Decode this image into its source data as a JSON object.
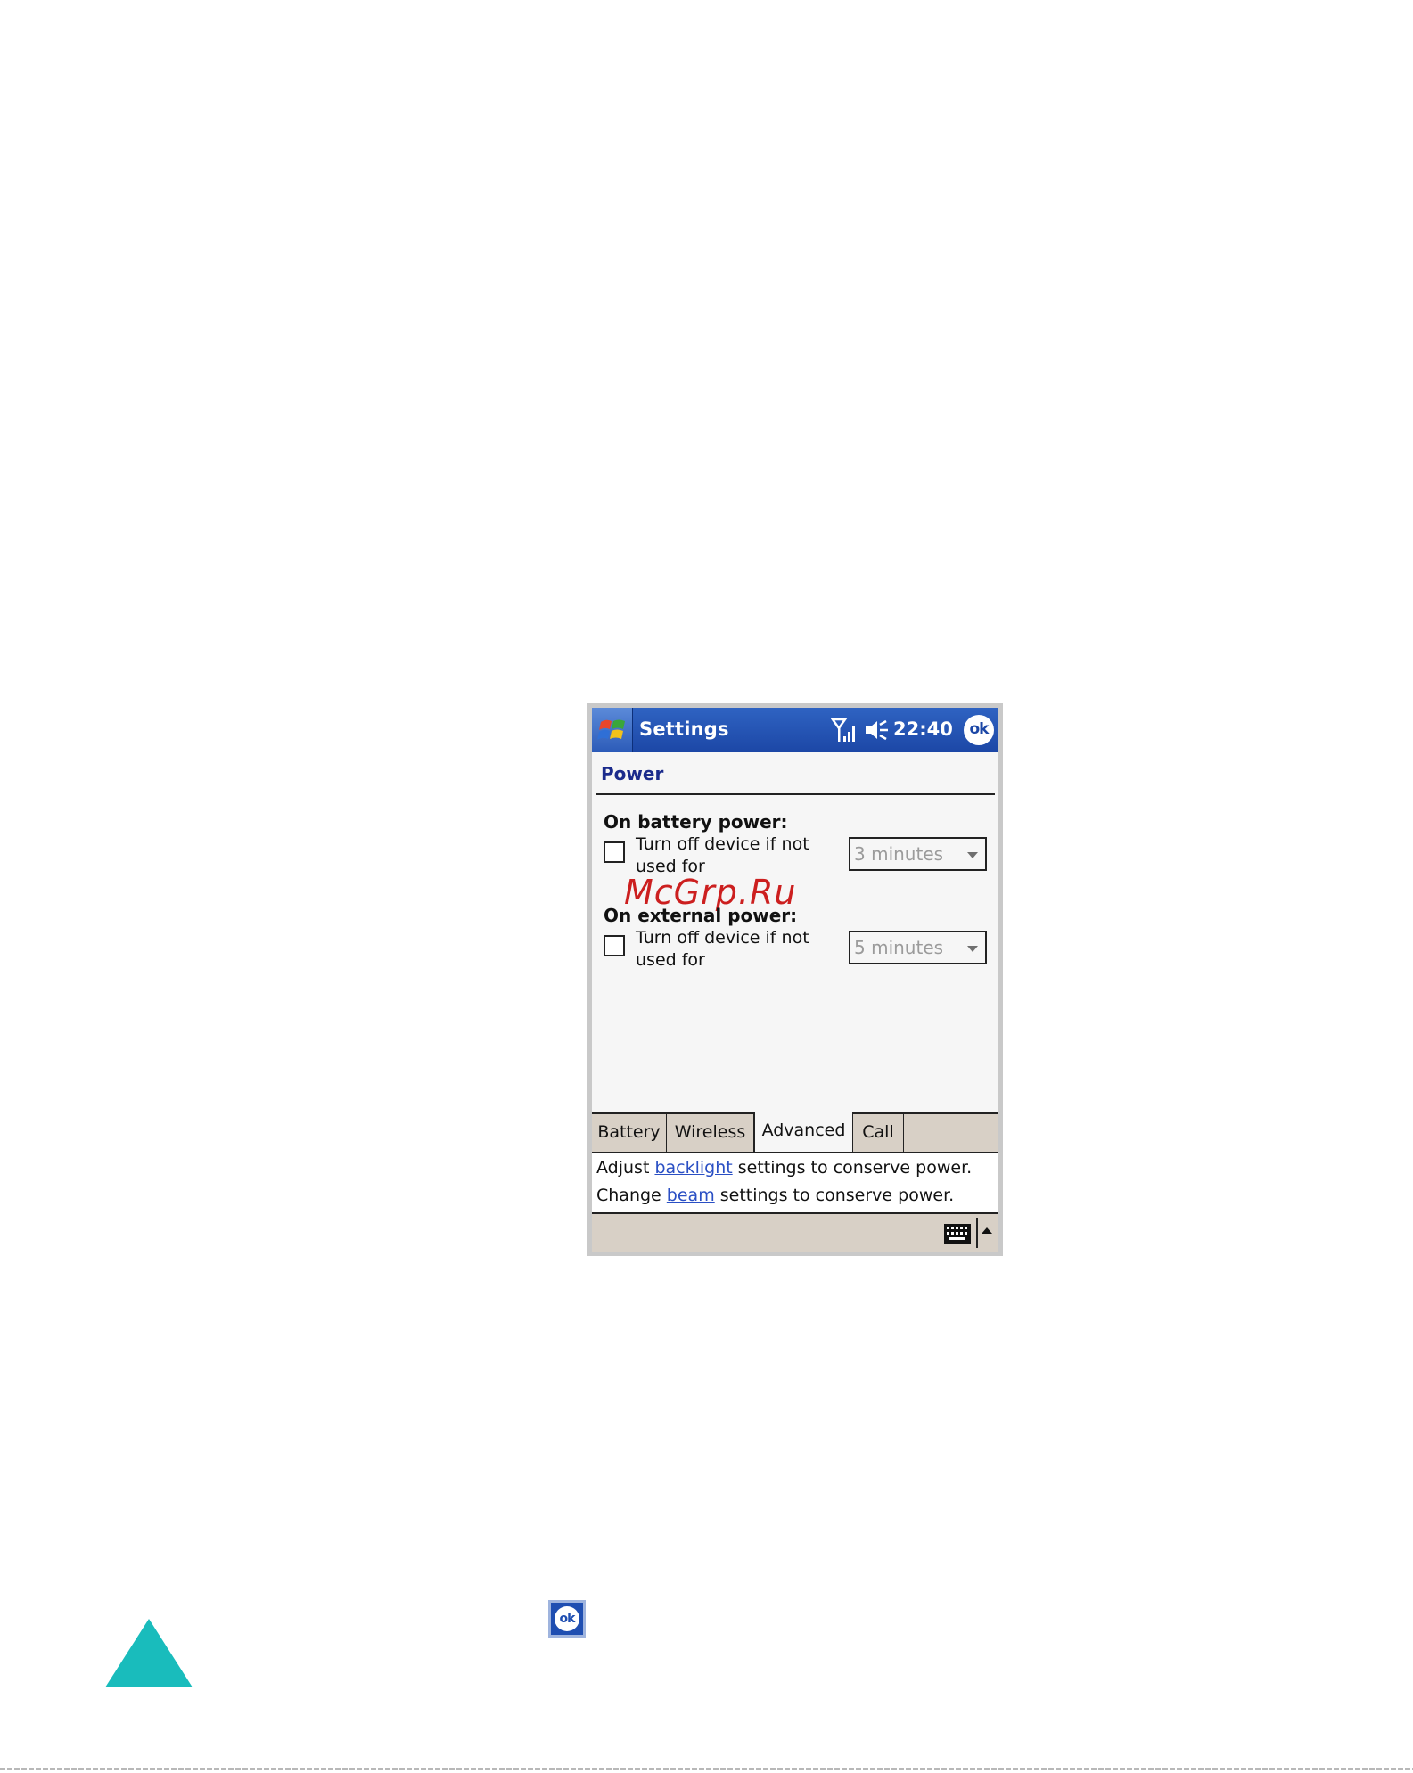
{
  "titlebar": {
    "app_title": "Settings",
    "clock": "22:40",
    "ok_label": "ok",
    "icons": [
      "windows-start-icon",
      "signal-strength-icon",
      "speaker-muted-icon"
    ]
  },
  "page": {
    "title": "Power"
  },
  "battery_power": {
    "heading": "On battery power:",
    "option_label": "Turn off device if not used for",
    "checked": false,
    "timeout_value": "3 minutes"
  },
  "external_power": {
    "heading": "On external power:",
    "option_label": "Turn off device if not used for",
    "checked": false,
    "timeout_value": "5 minutes"
  },
  "tabs": [
    {
      "label": "Battery",
      "active": false
    },
    {
      "label": "Wireless",
      "active": false
    },
    {
      "label": "Advanced",
      "active": true
    },
    {
      "label": "Call",
      "active": false
    }
  ],
  "info": {
    "line1_prefix": "Adjust ",
    "line1_link": "backlight",
    "line1_suffix": " settings to conserve power.",
    "line2_prefix": "Change ",
    "line2_link": "beam",
    "line2_suffix": " settings to conserve power."
  },
  "watermark": "McGrp.Ru",
  "reference_ok_label": "ok",
  "colors": {
    "titlebar": "#1c47a6",
    "accent_title": "#1b2b8c",
    "link": "#2a4fc4",
    "tab_strip": "#d8d0c6",
    "triangle": "#19bcbc"
  }
}
